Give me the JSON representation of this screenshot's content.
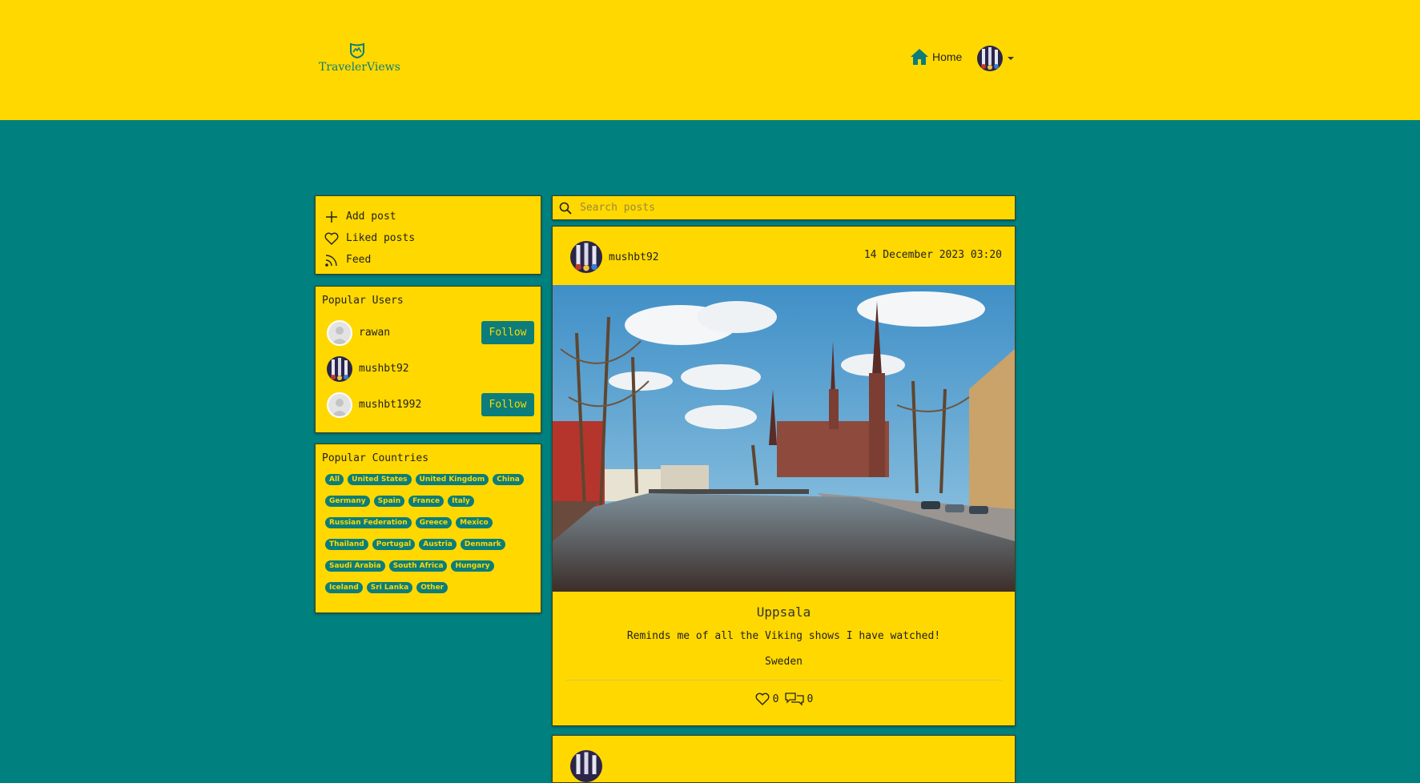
{
  "brand": {
    "name": "TravelerViews"
  },
  "nav": {
    "home_label": "Home"
  },
  "menu": {
    "items": [
      {
        "label": "Add post",
        "icon": "plus-icon"
      },
      {
        "label": "Liked posts",
        "icon": "heart-icon"
      },
      {
        "label": "Feed",
        "icon": "rss-icon"
      }
    ]
  },
  "popular_users": {
    "title": "Popular Users",
    "follow_label": "Follow",
    "users": [
      {
        "name": "rawan",
        "followable": true
      },
      {
        "name": "mushbt92",
        "followable": false
      },
      {
        "name": "mushbt1992",
        "followable": true
      }
    ]
  },
  "popular_countries": {
    "title": "Popular Countries",
    "chips": [
      "All",
      "United States",
      "United Kingdom",
      "China",
      "Germany",
      "Spain",
      "France",
      "Italy",
      "Russian Federation",
      "Greece",
      "Mexico",
      "Thailand",
      "Portugal",
      "Austria",
      "Denmark",
      "Saudi Arabia",
      "South Africa",
      "Hungary",
      "Iceland",
      "Sri Lanka",
      "Other"
    ]
  },
  "search": {
    "placeholder": "Search posts"
  },
  "post": {
    "author": "mushbt92",
    "date": "14 December 2023 03:20",
    "title": "Uppsala",
    "text": "Reminds me of all the Viking shows I have watched!",
    "country": "Sweden",
    "likes": "0",
    "comments": "0"
  },
  "colors": {
    "accent_yellow": "#ffd800",
    "accent_teal": "#00807f"
  }
}
